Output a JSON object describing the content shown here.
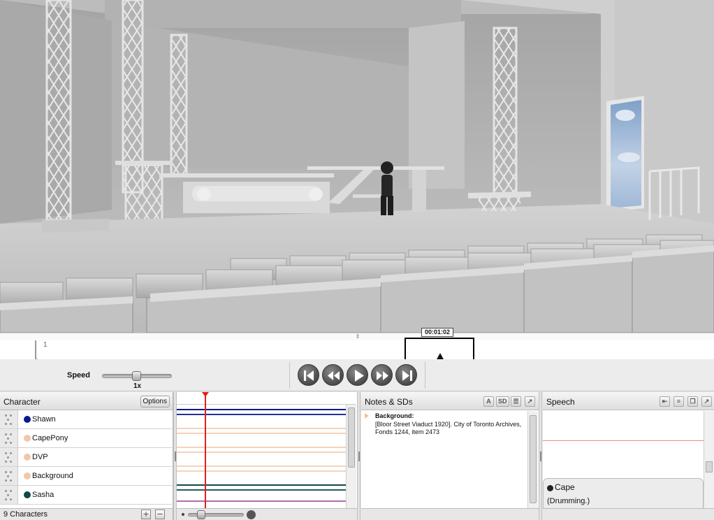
{
  "timeline": {
    "current_time": "00:01:02",
    "marker_number": "1"
  },
  "transport": {
    "speed_label": "Speed",
    "speed_value": "1x",
    "buttons": [
      "step-back-icon",
      "rewind-icon",
      "play-icon",
      "fast-forward-icon",
      "step-forward-icon"
    ]
  },
  "characters": {
    "title": "Character",
    "options_label": "Options",
    "count_label": "9 Characters",
    "add_label": "+",
    "remove_label": "−",
    "items": [
      {
        "name": "Shawn",
        "color": "#0a1a8c"
      },
      {
        "name": "CapePony",
        "color": "#f1c7a8"
      },
      {
        "name": "DVP",
        "color": "#f1c7a8"
      },
      {
        "name": "Background",
        "color": "#f1c7a8"
      },
      {
        "name": "Sasha",
        "color": "#0f4a48"
      }
    ]
  },
  "lanes": {
    "colors": [
      "#0a1a8c",
      "#f4d3bb",
      "#f4d3bb",
      "#f4d3bb",
      "#0f4a48"
    ]
  },
  "notes": {
    "title": "Notes & SDs",
    "tool_a": "A",
    "tool_sd": "SD",
    "entry_heading": "Background:",
    "entry_text": "[Bloor Street Viaduct 1920]. City of Toronto Archives, Fonds 1244, item 2473"
  },
  "speech": {
    "title": "Speech",
    "card_name": "Cape",
    "card_line": "(Drumming.)"
  }
}
